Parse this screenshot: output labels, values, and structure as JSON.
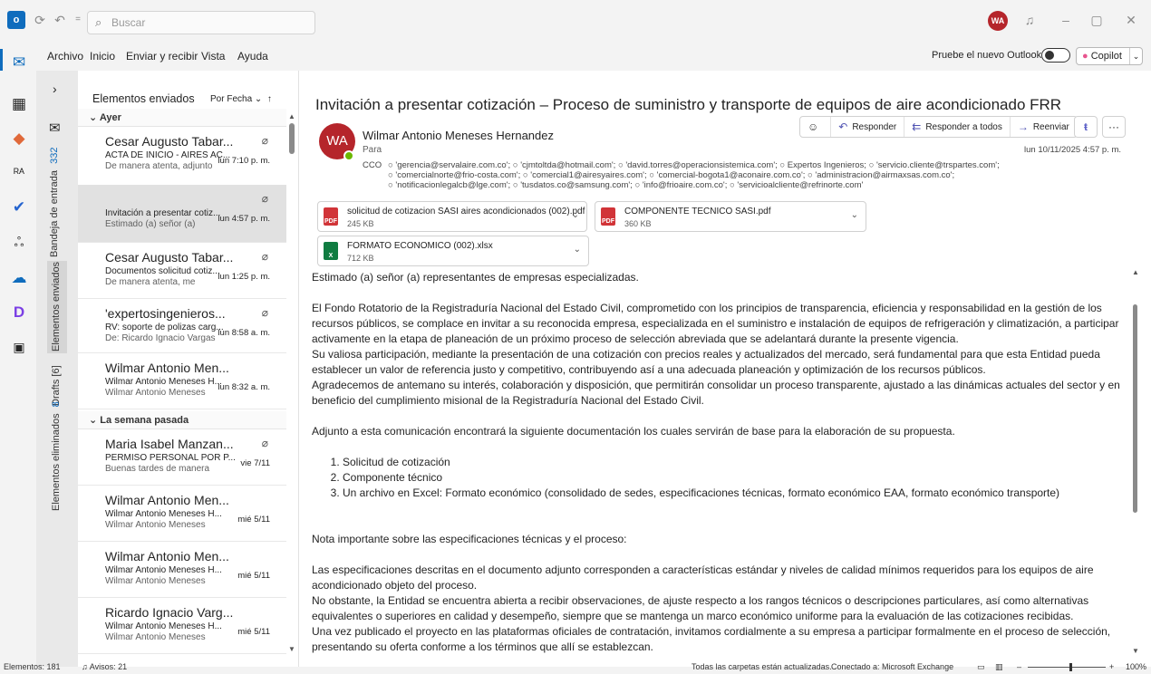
{
  "search": {
    "placeholder": "Buscar"
  },
  "account": {
    "initials": "WA"
  },
  "menu": [
    "Archivo",
    "Inicio",
    "Enviar y recibir",
    "Vista",
    "Ayuda"
  ],
  "try_new": "Pruebe el nuevo Outlook",
  "copilot": "Copilot",
  "folders": {
    "inbox": "Bandeja de entrada",
    "inbox_count": "332",
    "sent": "Elementos enviados",
    "drafts": "Drafts [6]",
    "deleted": "Elementos eliminados",
    "deleted_count": "8"
  },
  "list": {
    "title": "Elementos enviados",
    "sort": "Por Fecha",
    "groups": [
      "Ayer",
      "La semana pasada"
    ],
    "messages": [
      {
        "from": "Cesar Augusto Tabar...",
        "subject": "ACTA DE INICIO - AIRES AC...",
        "preview": "De manera atenta, adjunto",
        "date": "lun 7:10 p. m."
      },
      {
        "from": "",
        "subject": "Invitación a presentar cotiz...",
        "preview": "Estimado (a) señor (a)",
        "date": "lun 4:57 p. m."
      },
      {
        "from": "Cesar Augusto Tabar...",
        "subject": "Documentos solicitud cotiz...",
        "preview": "De manera atenta, me",
        "date": "lun 1:25 p. m."
      },
      {
        "from": "'expertosingenieros...",
        "subject": "RV: soporte de polizas carg...",
        "preview": "De: Ricardo Ignacio Vargas",
        "date": "lun 8:58 a. m."
      },
      {
        "from": "Wilmar Antonio Men...",
        "subject": "Wilmar Antonio Meneses H...",
        "preview": "Wilmar Antonio Meneses",
        "date": "lun 8:32 a. m."
      },
      {
        "from": "Maria Isabel Manzan...",
        "subject": "PERMISO PERSONAL POR P...",
        "preview": "Buenas tardes de manera",
        "date": "vie 7/11"
      },
      {
        "from": "Wilmar Antonio Men...",
        "subject": "Wilmar Antonio Meneses H...",
        "preview": "Wilmar Antonio Meneses",
        "date": "mié 5/11"
      },
      {
        "from": "Wilmar Antonio Men...",
        "subject": "Wilmar Antonio Meneses H...",
        "preview": "Wilmar Antonio Meneses",
        "date": "mié 5/11"
      },
      {
        "from": "Ricardo Ignacio Varg...",
        "subject": "Wilmar Antonio Meneses H...",
        "preview": "Wilmar Antonio Meneses",
        "date": "mié 5/11"
      }
    ]
  },
  "email": {
    "subject": "Invitación a presentar cotización – Proceso de suministro y transporte de equipos de aire acondicionado FRR",
    "sender_initials": "WA",
    "sender": "Wilmar Antonio Meneses Hernandez",
    "para_label": "Para",
    "cco_label": "CCO",
    "cco_line1": "○ 'gerencia@servalaire.com.co'; ○ 'cjmtoltda@hotmail.com'; ○ 'david.torres@operacionsistemica.com'; ○ Expertos Ingenieros; ○ 'servicio.cliente@trspartes.com';",
    "cco_line2": "○ 'comercialnorte@frio-costa.com'; ○ 'comercial1@airesyaires.com'; ○ 'comercial-bogota1@aconaire.com.co'; ○ 'administracion@airmaxsas.com.co';",
    "cco_line3": "○ 'notificacionlegalcb@lge.com'; ○ 'tusdatos.co@samsung.com'; ○ 'info@frioaire.com.co'; ○ 'servicioalcliente@refrinorte.com'",
    "date": "lun 10/11/2025 4:57 p. m.",
    "actions": {
      "reply": "Responder",
      "reply_all": "Responder a todos",
      "forward": "Reenviar"
    },
    "attachments": [
      {
        "name": "solicitud de cotizacion SASI aires acondicionados (002).pdf",
        "size": "245 KB",
        "type": "PDF"
      },
      {
        "name": "COMPONENTE TECNICO SASI.pdf",
        "size": "360 KB",
        "type": "PDF"
      },
      {
        "name": "FORMATO ECONOMICO (002).xlsx",
        "size": "712 KB",
        "type": "X"
      }
    ],
    "greeting": "Estimado (a) señor (a) representantes de empresas especializadas.",
    "p1": "El Fondo Rotatorio de la Registraduría Nacional del Estado Civil, comprometido con los principios de transparencia, eficiencia y responsabilidad en la gestión de los recursos públicos, se complace en invitar a su reconocida empresa, especializada en el suministro e instalación de equipos de refrigeración y climatización, a participar activamente en la etapa de planeación de un próximo proceso de selección abreviada que se adelantará durante la presente vigencia.",
    "p2": "Su valiosa participación, mediante la presentación de una cotización con precios reales y actualizados del mercado, será fundamental para que esta Entidad pueda establecer un valor de referencia justo y competitivo, contribuyendo así a una adecuada planeación y optimización de los recursos públicos.",
    "p3": "Agradecemos de antemano su interés, colaboración y disposición, que permitirán consolidar un proceso transparente, ajustado a las dinámicas actuales del sector y en beneficio del cumplimiento misional de la Registraduría Nacional del Estado Civil.",
    "p4": "Adjunto a esta comunicación encontrará la siguiente documentación los cuales servirán de base para la elaboración de su propuesta.",
    "list": [
      "Solicitud de cotización",
      "Componente técnico",
      "Un archivo en Excel: Formato económico (consolidado de sedes, especificaciones técnicas, formato económico EAA, formato económico transporte)"
    ],
    "note_title": "Nota importante sobre las especificaciones técnicas y el proceso:",
    "p5": "Las especificaciones descritas en el documento adjunto corresponden a características estándar y niveles de calidad mínimos requeridos para los equipos de aire acondicionado objeto del proceso.",
    "p6": "No obstante, la Entidad se encuentra abierta a recibir observaciones, de ajuste respecto a los rangos técnicos o descripciones particulares, así como alternativas equivalentes o superiores en calidad y desempeño, siempre que se mantenga un marco económico uniforme para la evaluación de las cotizaciones recibidas.",
    "p7": "Una vez publicado el proyecto en las plataformas oficiales de contratación, invitamos cordialmente a su empresa a participar formalmente en el proceso de selección, presentando su oferta conforme a los términos que allí se establezcan."
  },
  "status": {
    "items": "Elementos: 181",
    "alerts": "Avisos: 21",
    "updated": "Todas las carpetas están actualizadas.",
    "connected": "Conectado a: Microsoft Exchange",
    "zoom": "100%"
  }
}
